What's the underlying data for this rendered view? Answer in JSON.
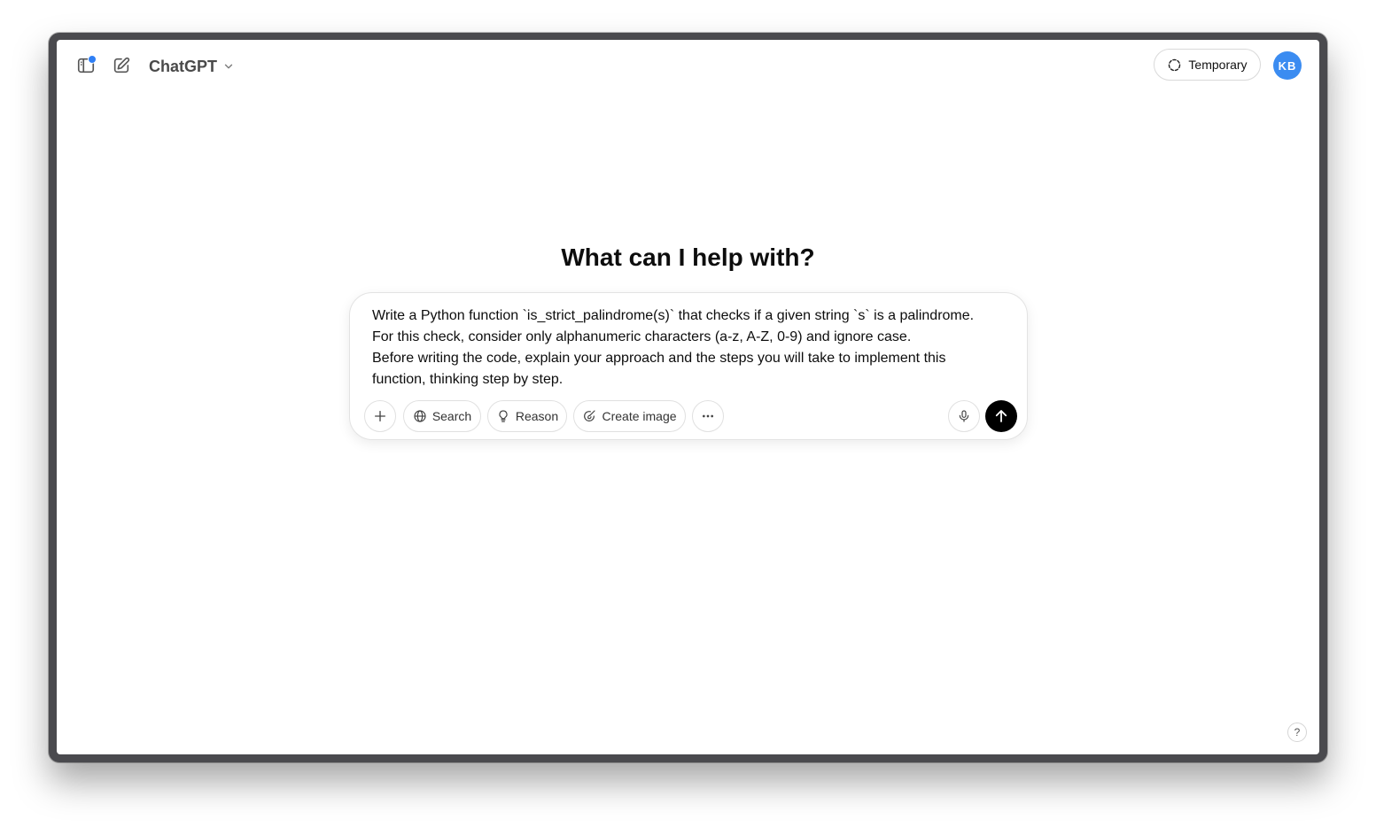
{
  "header": {
    "model_name": "ChatGPT",
    "temporary_label": "Temporary",
    "avatar_initials": "KB"
  },
  "main": {
    "headline": "What can I help with?"
  },
  "composer": {
    "prompt_lines": [
      "Write a Python function `is_strict_palindrome(s)` that checks if a given string `s` is a palindrome.",
      "For this check, consider only alphanumeric characters (a-z, A-Z, 0-9) and ignore case.",
      "Before writing the code, explain your approach and the steps you will take to implement this",
      "function, thinking step by step."
    ],
    "search_label": "Search",
    "reason_label": "Reason",
    "create_image_label": "Create image"
  },
  "footer": {
    "help_label": "?"
  },
  "colors": {
    "accent_blue": "#3b8cf1",
    "notification_dot": "#2f7ff5",
    "send_button": "#000000"
  },
  "icons": [
    "sidebar-toggle-icon",
    "new-chat-icon",
    "chevron-down-icon",
    "dashed-circle-icon",
    "plus-icon",
    "globe-icon",
    "lightbulb-icon",
    "brush-icon",
    "ellipsis-icon",
    "microphone-icon",
    "arrow-up-icon"
  ]
}
